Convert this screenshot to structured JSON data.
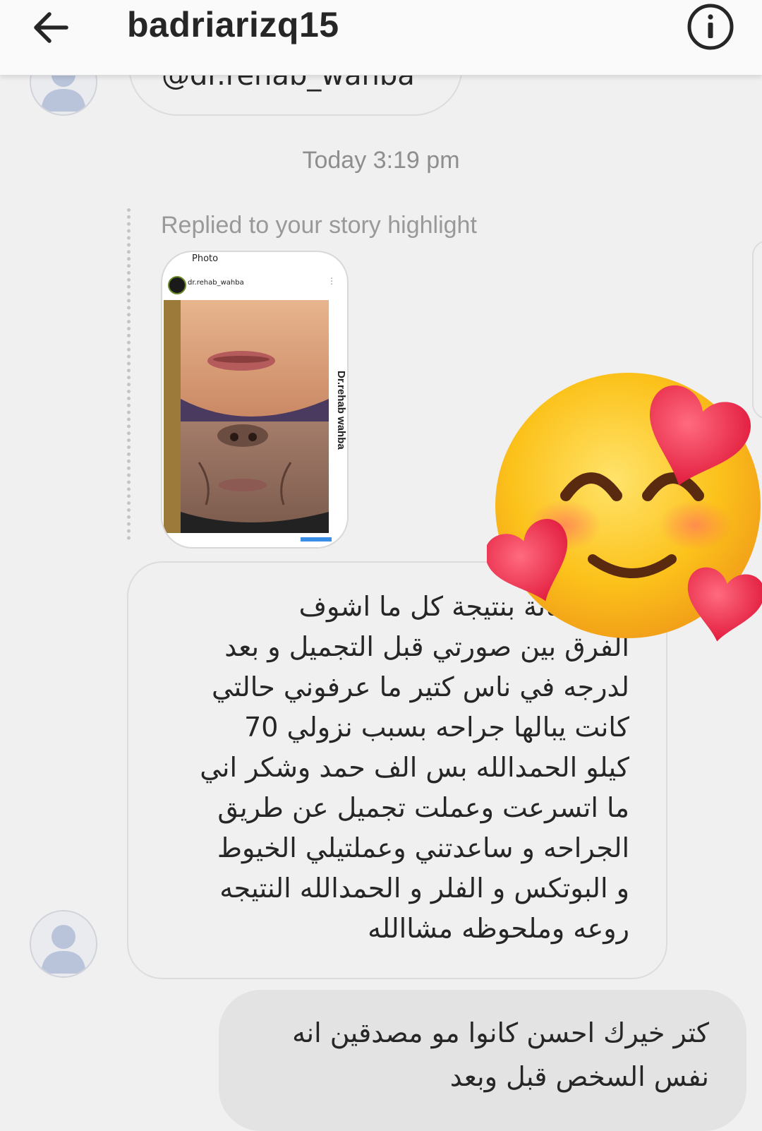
{
  "header": {
    "username": "badriarizq15",
    "back_icon": "arrow-left-icon",
    "info_icon": "info-circle-icon"
  },
  "conversation": {
    "previous_message_fragment": "@dr.rehab_wahba",
    "timestamp": "Today 3:19 pm",
    "reply_label": "Replied to your story highlight",
    "story": {
      "type_label": "Photo",
      "account": "dr.rehab_wahba",
      "watermark": "Dr.rehab wahba"
    },
    "received_message": {
      "lines": [
        "انا فرحانة بنتيجة كل ما اشوف",
        "الفرق بين صورتي قبل التجميل و بعد",
        "لدرجه في ناس كتير ما عرفوني حالتي",
        "كانت يبالها جراحه بسبب نزولي 70",
        "كيلو الحمدالله بس الف حمد وشكر اني",
        "ما اتسرعت وعملت تجميل عن طريق",
        "الجراحه و ساعدتني وعملتيلي الخيوط",
        "و البوتكس و الفلر و الحمدالله النتيجه",
        "روعه وملحوظه مشاالله"
      ]
    },
    "sent_message": {
      "lines": [
        "كتر خيرك احسن كانوا مو مصدقين انه",
        "نفس السخص قبل وبعد"
      ]
    },
    "reaction_sticker": "smiling-face-with-hearts-icon"
  },
  "colors": {
    "text": "#262626",
    "muted": "#8e8e8e",
    "background": "#f0f0f0",
    "sent_bubble": "#e3e3e3",
    "heart": "#f0344f",
    "emoji_face": "#fcc21b"
  }
}
